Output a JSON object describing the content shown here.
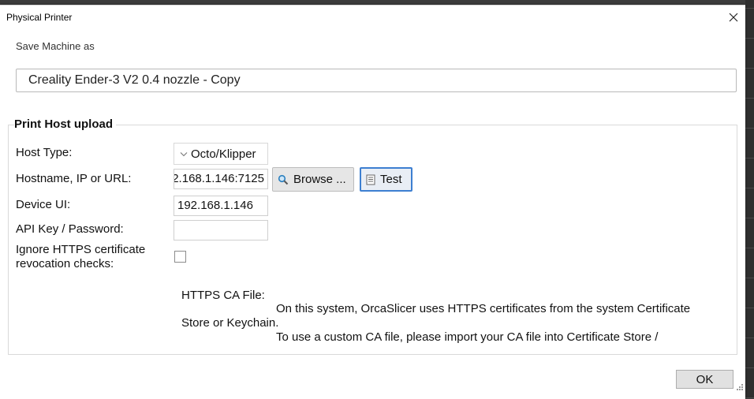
{
  "dialog": {
    "title": "Physical Printer",
    "close_icon": "close-icon"
  },
  "save": {
    "label": "Save Machine as",
    "value": "Creality Ender-3 V2 0.4 nozzle - Copy"
  },
  "group": {
    "legend": "Print Host upload",
    "host_type_label": "Host Type:",
    "host_type_value": "Octo/Klipper",
    "hostname_label": "Hostname, IP or URL:",
    "hostname_value": "2.168.1.146:7125",
    "browse_label": "Browse ...",
    "test_label": "Test",
    "device_ui_label": "Device UI:",
    "device_ui_value": "192.168.1.146",
    "api_key_label": "API Key / Password:",
    "api_key_value": "",
    "ignore_https_label_1": "Ignore HTTPS certificate",
    "ignore_https_label_2": "revocation checks:",
    "ignore_https_checked": false,
    "ca_file_label": "HTTPS CA File:",
    "ca_info_line1": "On this system, OrcaSlicer uses HTTPS certificates from the system Certificate",
    "ca_info_line2": "Store or Keychain.",
    "ca_info_line3": "To use a custom CA file, please import your CA file into Certificate Store /"
  },
  "footer": {
    "ok_label": "OK"
  },
  "icons": {
    "browse": "search-icon",
    "test": "document-icon",
    "dropdown": "chevron-down-icon"
  },
  "colors": {
    "accent": "#3d7fd1",
    "dialog_bg": "#ffffff",
    "backdrop": "#3c3c3c"
  }
}
